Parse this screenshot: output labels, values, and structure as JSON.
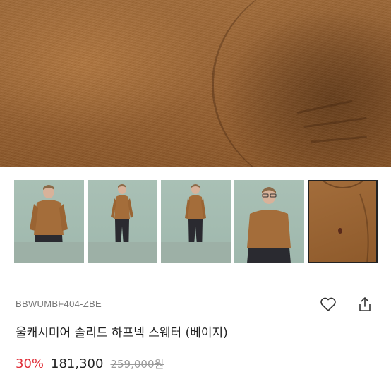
{
  "hero": {
    "icon": "knit-sweater-closeup"
  },
  "thumbnails": [
    {
      "icon": "model-seated"
    },
    {
      "icon": "model-standing"
    },
    {
      "icon": "model-standing"
    },
    {
      "icon": "model-upper-body"
    },
    {
      "icon": "sweater-closeup",
      "selected": true
    }
  ],
  "product": {
    "code": "BBWUMBF404-ZBE",
    "name": "울캐시미어 솔리드 하프넥 스웨터 (베이지)",
    "discount": "30%",
    "price": "181,300",
    "original_price": "259,000원"
  },
  "actions": {
    "wishlist_icon": "heart-icon",
    "share_icon": "share-icon"
  },
  "colors": {
    "discount": "#e0303a",
    "sweater": "#a06a38",
    "backdrop": "#a9c0b5"
  }
}
